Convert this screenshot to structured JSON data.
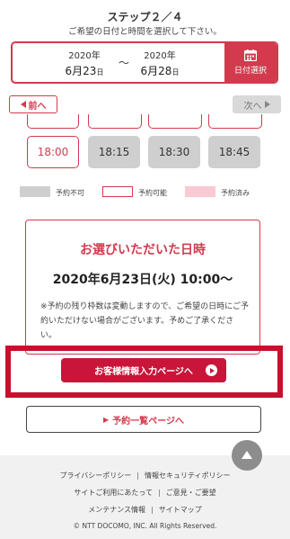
{
  "header": {
    "step": "ステップ２／４",
    "instruction": "ご希望の日付と時間を選択して下さい。"
  },
  "date_range": {
    "from_year": "2020年",
    "from_month": "6月",
    "from_day": "23",
    "from_day_suffix": "日",
    "separator": "〜",
    "to_year": "2020年",
    "to_month": "6月",
    "to_day": "28",
    "to_day_suffix": "日",
    "select_button": "日付選択",
    "select_icon": "calendar-icon"
  },
  "nav": {
    "prev": "前へ",
    "next": "次へ"
  },
  "slots": [
    {
      "time": "18:00",
      "status": "available"
    },
    {
      "time": "18:15",
      "status": "unavailable"
    },
    {
      "time": "18:30",
      "status": "unavailable"
    },
    {
      "time": "18:45",
      "status": "unavailable"
    }
  ],
  "legend": {
    "unavailable": "予約不可",
    "available": "予約可能",
    "booked": "予約済み"
  },
  "result": {
    "title": "お選びいただいた日時",
    "selected": "2020年6月23日(火) 10:00〜",
    "note": "※予約の残り枠数は変動しますので、ご希望の日時にご予約いただけない場合がございます。予めご了承ください。"
  },
  "buttons": {
    "customer_info": "お客様情報入力ページへ",
    "reservation_list": "予約一覧ページへ"
  },
  "footer": {
    "links_row1": [
      "プライバシーポリシー",
      "情報セキュリティポリシー"
    ],
    "links_row2": [
      "サイトご利用にあたって",
      "ご意見・ご要望"
    ],
    "links_row3": [
      "メンテナンス情報",
      "サイトマップ"
    ],
    "copyright": "© NTT DOCOMO, INC. All Rights Reserved."
  },
  "colors": {
    "accent": "#d33a4e",
    "highlight": "#c8102e",
    "unavailable": "#cfcfcf",
    "booked": "#f9c9d4"
  }
}
